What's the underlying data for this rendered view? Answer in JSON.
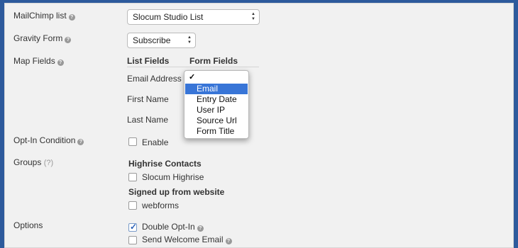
{
  "labels": {
    "mailchimp_list": "MailChimp list",
    "gravity_form": "Gravity Form",
    "map_fields": "Map Fields",
    "opt_in_condition": "Opt-In Condition",
    "groups": "Groups",
    "groups_help": "(?)",
    "options": "Options"
  },
  "help_glyph": "?",
  "mailchimp_list_select": {
    "value": "Slocum Studio List"
  },
  "gravity_form_select": {
    "value": "Subscribe"
  },
  "map_fields": {
    "col_list_fields": "List Fields",
    "col_form_fields": "Form Fields",
    "rows": [
      {
        "label": "Email Address",
        "required_mark": "*"
      },
      {
        "label": "First Name"
      },
      {
        "label": "Last Name"
      }
    ]
  },
  "dropdown": {
    "check_glyph": "✓",
    "items": [
      "Email",
      "Entry Date",
      "User IP",
      "Source Url",
      "Form Title"
    ],
    "highlighted_index": 0
  },
  "opt_in": {
    "enable_label": "Enable",
    "checked": false
  },
  "groups": [
    {
      "heading": "Highrise Contacts",
      "option": "Slocum Highrise",
      "checked": false
    },
    {
      "heading": "Signed up from website",
      "option": "webforms",
      "checked": false
    }
  ],
  "options": {
    "double_opt_in": {
      "label": "Double Opt-In",
      "checked": true
    },
    "send_welcome_email": {
      "label": "Send Welcome Email",
      "checked": false
    }
  },
  "check_glyph": "✓",
  "updown_glyphs": {
    "up": "▲",
    "down": "▼"
  },
  "colors": {
    "frame_border": "#2d5a9c",
    "panel_bg": "#f1f1f1",
    "highlight": "#3875d7",
    "required": "#cc2222"
  }
}
